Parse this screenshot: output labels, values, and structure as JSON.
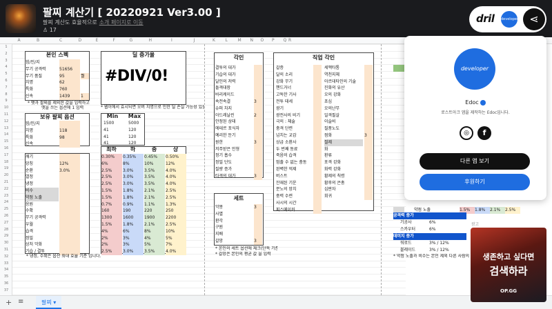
{
  "header": {
    "title": "팔찌 계산기 [ 20220921 Ver3.00 ]",
    "subtitle": "팔찌 계산도 효율적으로",
    "subtitle_link": "소개 페이지로 이동",
    "users": "17"
  },
  "brand": {
    "logo_text": "dril",
    "avatar_text": "developer"
  },
  "panel": {
    "avatar_text": "developer",
    "name": "Edoc",
    "desc": "로스트아크 앱을 제작하는 Edoc입니다.",
    "other_apps": "다른 앱 보기",
    "sponsor": "후원하기"
  },
  "ad": {
    "line1": "생존하고 싶다면",
    "line2": "검색하라",
    "brand": "OP.GG",
    "label": "광고"
  },
  "tabs": {
    "sheet1": "팔찌"
  },
  "columns": [
    "A",
    "B",
    "C",
    "D",
    "E",
    "F",
    "G",
    "H",
    "I",
    "J",
    "K",
    "L",
    "M",
    "N",
    "O",
    "P",
    "Q",
    "R"
  ],
  "rows": [
    "1",
    "2",
    "3",
    "4",
    "5",
    "6",
    "7",
    "8",
    "9",
    "10",
    "11",
    "12",
    "13",
    "14",
    "15",
    "16",
    "17",
    "18",
    "19",
    "20",
    "21",
    "22",
    "23",
    "24",
    "25",
    "26",
    "27",
    "28",
    "29",
    "30",
    "31",
    "32",
    "33",
    "34",
    "35",
    "36",
    "37"
  ],
  "spec": {
    "title": "본인 스펙",
    "rows": [
      [
        "힘/민/지",
        ""
      ],
      [
        "무기 공격력",
        "51656"
      ],
      [
        "무기 품질",
        "95",
        "퀄"
      ],
      [
        "치명",
        "62"
      ],
      [
        "특화",
        "760"
      ],
      [
        "신속",
        "1439",
        "1"
      ]
    ],
    "note1": "* 팻과 팔찌를 제외한 값을 입력하고",
    "note2": "옛을 쓰는 옵션에 1 입력"
  },
  "owned": {
    "title": "보유 팔찌 옵션",
    "rows": [
      [
        "힘/민/지",
        ""
      ],
      [
        "치명",
        "118"
      ],
      [
        "특화",
        "98"
      ],
      [
        "신속",
        ""
      ]
    ]
  },
  "extra": {
    "rows": [
      [
        "깨기",
        ""
      ],
      [
        "앙칭",
        "12%"
      ],
      [
        "순환",
        "3.0%"
      ],
      [
        "열정",
        ""
      ],
      [
        "냉정",
        ""
      ],
      [
        "비수",
        ""
      ],
      [
        "약점 노출",
        ""
      ],
      [
        "응원",
        ""
      ],
      [
        "수확",
        ""
      ],
      [
        "무기 공격력",
        ""
      ],
      [
        "우월",
        ""
      ],
      [
        "습격",
        ""
      ],
      [
        "정밀",
        ""
      ],
      [
        "상처 악화",
        ""
      ],
      [
        "기습 / 결투",
        ""
      ]
    ],
    "note": "* 냉정, 수확은 옵션 최대 효율 기준 입니다."
  },
  "dill": {
    "title": "딜 증가율",
    "value": "#DIV/0!",
    "note": "* 웹이에서 효시되면 오버 치명으로 인한 딜 손실 가능성 있음"
  },
  "minmax": {
    "headers": [
      "Min",
      "Max"
    ],
    "rows": [
      [
        "1500",
        "5000"
      ],
      [
        "41",
        "120"
      ],
      [
        "41",
        "120"
      ],
      [
        "41",
        "120"
      ]
    ]
  },
  "grade": {
    "headers": [
      "최하",
      "하",
      "중",
      "상"
    ],
    "rows": [
      [
        "0.30%",
        "0.35%",
        "0.45%",
        "0.50%"
      ],
      [
        "6%",
        "8%",
        "10%",
        "12%"
      ],
      [
        "2.5%",
        "3.0%",
        "3.5%",
        "4.0%"
      ],
      [
        "2.5%",
        "3.0%",
        "3.5%",
        "4.0%"
      ],
      [
        "2.5%",
        "3.0%",
        "3.5%",
        "4.0%"
      ],
      [
        "1.5%",
        "1.8%",
        "2.1%",
        "2.5%"
      ],
      [
        "1.5%",
        "1.8%",
        "2.1%",
        "2.5%"
      ],
      [
        "0.7%",
        "0.9%",
        "1.1%",
        "1.3%"
      ],
      [
        "160",
        "190",
        "220",
        "250"
      ],
      [
        "1300",
        "1600",
        "1900",
        "2200"
      ],
      [
        "1.5%",
        "1.8%",
        "2.1%",
        "2.5%"
      ],
      [
        "4%",
        "6%",
        "8%",
        "10%"
      ],
      [
        "2%",
        "3%",
        "4%",
        "5%"
      ],
      [
        "2%",
        "3%",
        "5%",
        "7%"
      ],
      [
        "2.5%",
        "3.0%",
        "3.5%",
        "4.0%"
      ]
    ]
  },
  "engrave": {
    "title": "각인",
    "rows": [
      [
        "결투의 대가",
        ""
      ],
      [
        "기습의 대가",
        ""
      ],
      [
        "달인의 저력",
        ""
      ],
      [
        "돌격대장",
        ""
      ],
      [
        "바리케이드",
        ""
      ],
      [
        "속전속결",
        "3"
      ],
      [
        "슈퍼 차지",
        ""
      ],
      [
        "아드레날린",
        "2"
      ],
      [
        "안정된 상태",
        ""
      ],
      [
        "에테르 포식자",
        ""
      ],
      [
        "예리한 둔기",
        ""
      ],
      [
        "원한",
        "3"
      ],
      [
        "저주받은 인형",
        ""
      ],
      [
        "정기 흡수",
        ""
      ],
      [
        "정밀 단도",
        ""
      ],
      [
        "질량 증가",
        ""
      ],
      [
        "타격의 대가",
        "3"
      ]
    ]
  },
  "set": {
    "title": "세트",
    "rows": [
      [
        "악몽",
        "3"
      ],
      [
        "사멸",
        ""
      ],
      [
        "환각",
        ""
      ],
      [
        "구원",
        ""
      ],
      [
        "지배",
        ""
      ],
      [
        "갈망",
        "3"
      ]
    ],
    "note1": "* 본인의 세트 옵션에 체크(단독 기준)",
    "note2": "* 갈망은 본인의 평균 값 을 입력"
  },
  "job": {
    "title": "직업 각인",
    "left": [
      "갈증",
      "달의 소리",
      "강화 무기",
      "핸드거너",
      "고독한 기사",
      "전투 태세",
      "광기",
      "광전사의 비기",
      "극의 : 체술",
      "충격 단련",
      "넘치는 교감",
      "상급 소환사",
      "두 번째 동료",
      "죽음의 습격",
      "멈출 수 없는 충동",
      "완벽한 억제",
      "버스트",
      "잔재된 기운",
      "분노의 망치",
      "중력 수련",
      "사시의 시간",
      "피스메이커"
    ],
    "right": [
      "세맥타통",
      "역천지체",
      "아르데타인의 기술",
      "진화의 유산",
      "오의 강화",
      "초심",
      "오의난무",
      "일격필살",
      "이슬비",
      "질풍노도",
      "점화",
      "절제",
      "화",
      "환류",
      "포격 강화",
      "화력 강화",
      "황제의 칙령",
      "황후의 은총",
      "심판자",
      "회귀"
    ],
    "right_vals": [
      "",
      "",
      "",
      "",
      "",
      "",
      "",
      "",
      "",
      "",
      "3",
      "",
      "",
      "",
      "",
      "",
      "",
      "",
      "",
      ""
    ]
  },
  "right_sheet": {
    "attack_title": "공격력 증가",
    "attack_rows": [
      [
        "기공사",
        "6%"
      ],
      [
        "스카우터",
        "6%"
      ]
    ],
    "damage_title": "데미지 증가",
    "damage_rows": [
      [
        "워로드",
        "3% / 12%"
      ],
      [
        "블레이드",
        "3% / 12%"
      ]
    ],
    "weak_row": [
      "약점 노출",
      "1.5%",
      "1.8%",
      "2.1%",
      "2.5%"
    ],
    "note": "* 약점 노출과 비수는 본인 제외 다른 사람의 발썹에 의한 기준"
  }
}
